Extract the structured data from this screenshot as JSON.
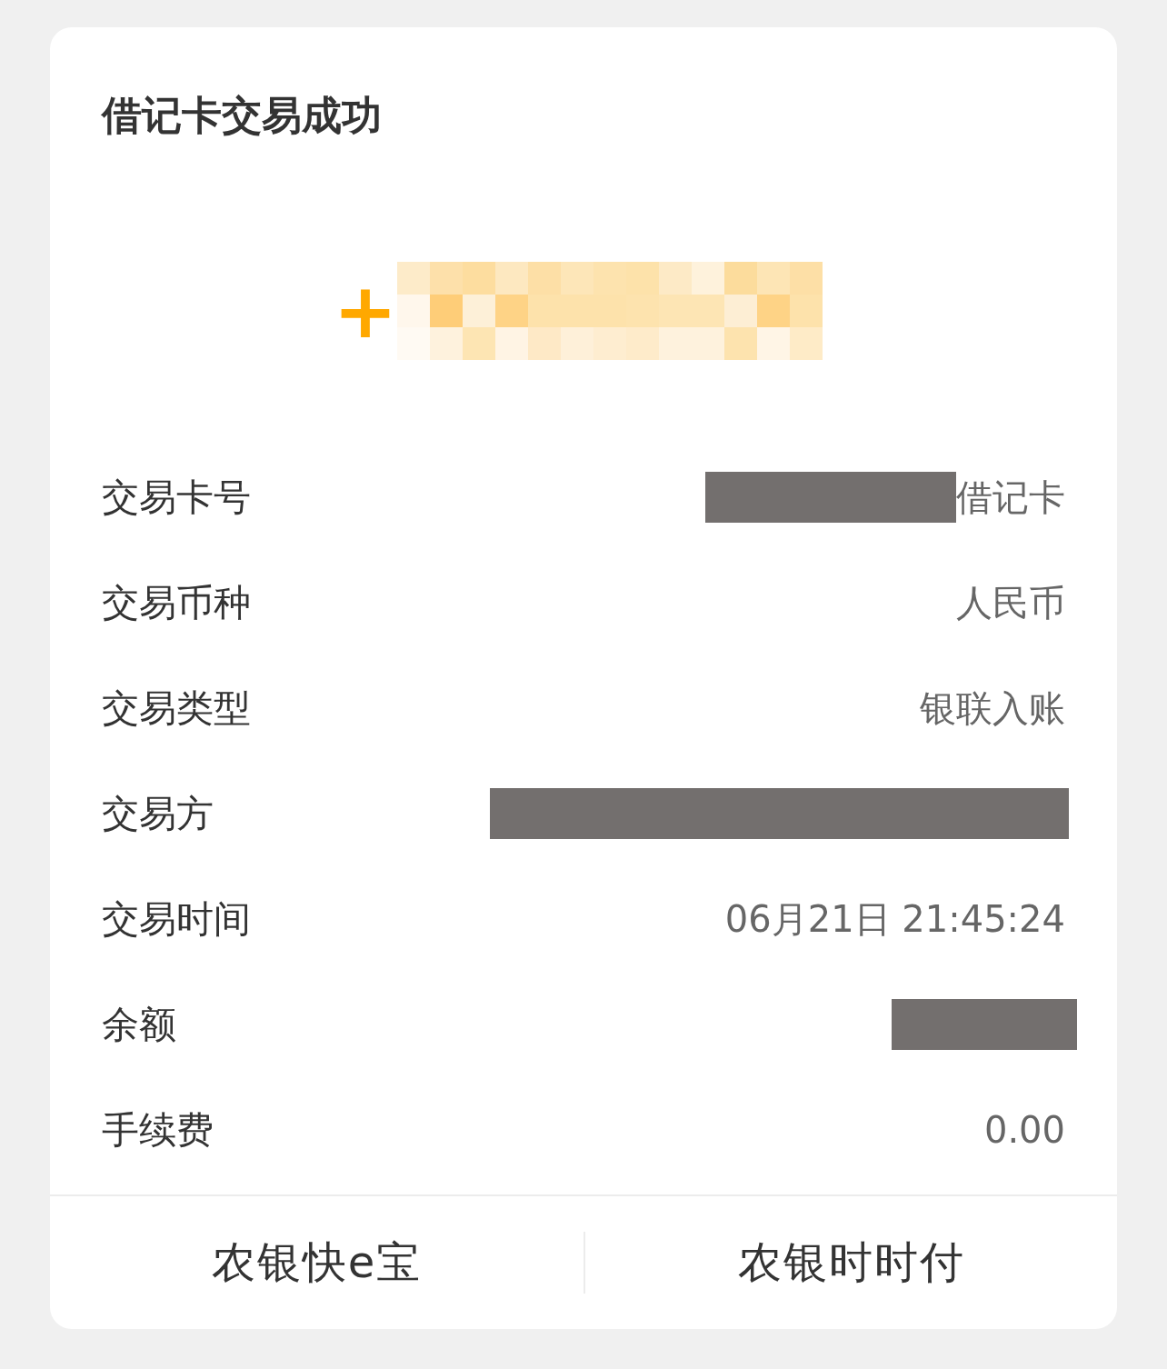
{
  "title": "借记卡交易成功",
  "amount": {
    "sign": "+"
  },
  "rows": [
    {
      "label": "交易卡号",
      "kind": "masked_text",
      "value": "借记卡"
    },
    {
      "label": "交易币种",
      "kind": "text",
      "value": "人民币"
    },
    {
      "label": "交易类型",
      "kind": "text",
      "value": "银联入账"
    },
    {
      "label": "交易方",
      "kind": "masked_long"
    },
    {
      "label": "交易时间",
      "kind": "text",
      "value": "06月21日 21:45:24"
    },
    {
      "label": "余额",
      "kind": "masked_short"
    },
    {
      "label": "手续费",
      "kind": "text",
      "value": "0.00"
    }
  ],
  "actions": [
    "农银快e宝",
    "农银时时付"
  ]
}
